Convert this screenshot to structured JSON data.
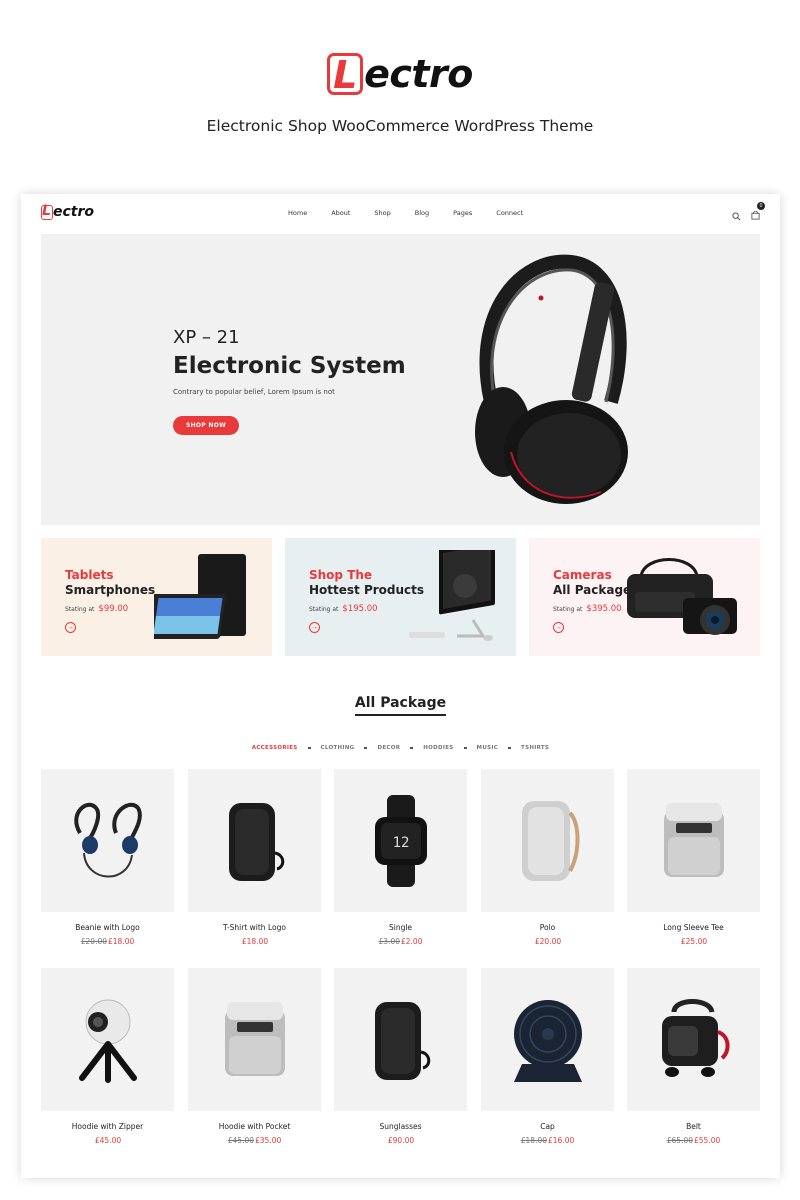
{
  "brand": {
    "logo_letter": "L",
    "logo_rest": "ectro",
    "tagline": "Electronic Shop WooCommerce WordPress Theme"
  },
  "header": {
    "nav": [
      "Home",
      "About",
      "Shop",
      "Blog",
      "Pages",
      "Connect"
    ],
    "cart_count": "0"
  },
  "hero": {
    "subtitle": "XP – 21",
    "title": "Electronic System",
    "description": "Contrary to popular belief, Lorem Ipsum is not",
    "button": "SHOP NOW"
  },
  "promos": [
    {
      "line1": "Tablets",
      "line2": "Smartphones",
      "starting": "Stating at",
      "price": "$99.00",
      "bg": "#fbf0e6"
    },
    {
      "line1": "Shop The",
      "line2": "Hottest Products",
      "starting": "Stating at",
      "price": "$195.00",
      "bg": "#e7eff1"
    },
    {
      "line1": "Cameras",
      "line2": "All Package",
      "starting": "Stating at",
      "price": "$395.00",
      "bg": "#fdf2f4"
    }
  ],
  "section": {
    "title": "All Package",
    "filters": [
      "ACCESSORIES",
      "CLOTHING",
      "DECOR",
      "HODDIES",
      "MUSIC",
      "TSHIRTS"
    ]
  },
  "products": [
    {
      "name": "Beanie with Logo",
      "old": "£20.00",
      "price": "£18.00",
      "icon": "earphones-icon"
    },
    {
      "name": "T-Shirt with Logo",
      "old": "",
      "price": "£18.00",
      "icon": "speaker-icon"
    },
    {
      "name": "Single",
      "old": "£3.00",
      "price": "£2.00",
      "icon": "smartwatch-icon"
    },
    {
      "name": "Polo",
      "old": "",
      "price": "£20.00",
      "icon": "silver-speaker-icon"
    },
    {
      "name": "Long Sleeve Tee",
      "old": "",
      "price": "£25.00",
      "icon": "ice-maker-icon"
    },
    {
      "name": "Hoodie with Zipper",
      "old": "",
      "price": "£45.00",
      "icon": "360-camera-icon"
    },
    {
      "name": "Hoodie with Pocket",
      "old": "£45.00",
      "price": "£35.00",
      "icon": "ice-maker-icon"
    },
    {
      "name": "Sunglasses",
      "old": "",
      "price": "£90.00",
      "icon": "speaker-icon"
    },
    {
      "name": "Cap",
      "old": "£18.00",
      "price": "£16.00",
      "icon": "fan-icon"
    },
    {
      "name": "Belt",
      "old": "£65.00",
      "price": "£55.00",
      "icon": "vacuum-icon"
    }
  ],
  "colors": {
    "accent": "#e8393b",
    "dark": "#222222"
  }
}
